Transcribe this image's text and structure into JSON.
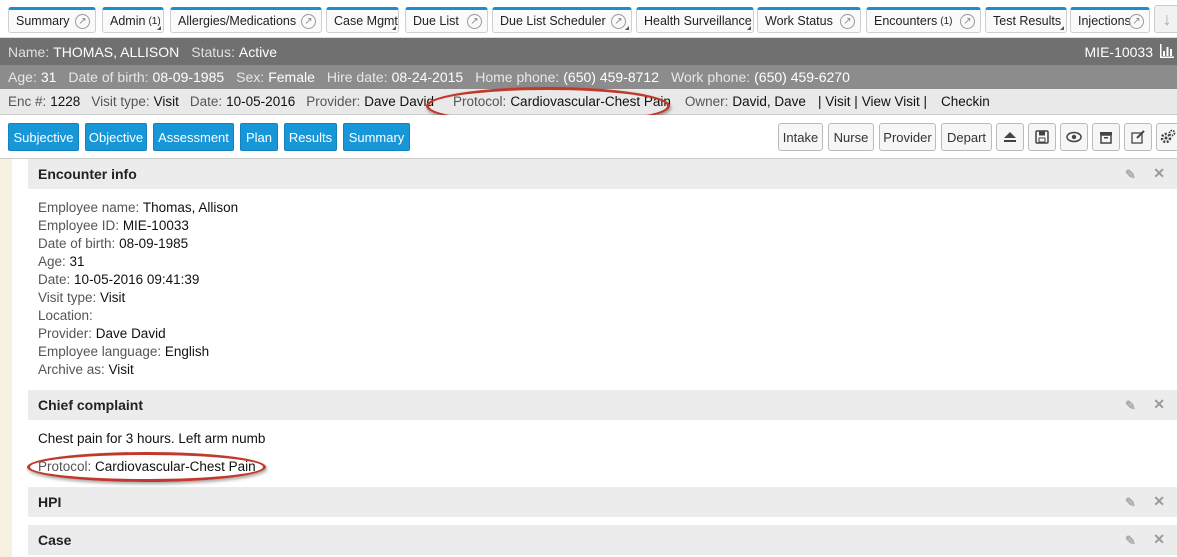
{
  "tabs": [
    {
      "label": "Summary",
      "count": ""
    },
    {
      "label": "Admin",
      "count": "(1)"
    },
    {
      "label": "Allergies/Medications",
      "count": ""
    },
    {
      "label": "Case Mgmt",
      "count": ""
    },
    {
      "label": "Due List",
      "count": ""
    },
    {
      "label": "Due List Scheduler",
      "count": ""
    },
    {
      "label": "Health Surveillance",
      "count": ""
    },
    {
      "label": "Work Status",
      "count": ""
    },
    {
      "label": "Encounters",
      "count": "(1)"
    },
    {
      "label": "Test Results",
      "count": ""
    },
    {
      "label": "Injections",
      "count": ""
    }
  ],
  "patient": {
    "name_label": "Name:",
    "name": "THOMAS, ALLISON",
    "status_label": "Status:",
    "status": "Active",
    "mrn": "MIE-10033",
    "age_label": "Age:",
    "age": "31",
    "dob_label": "Date of birth:",
    "dob": "08-09-1985",
    "sex_label": "Sex:",
    "sex": "Female",
    "hire_label": "Hire date:",
    "hire": "08-24-2015",
    "home_label": "Home phone:",
    "home": "(650) 459-8712",
    "work_label": "Work phone:",
    "work": "(650) 459-6270"
  },
  "encounter": {
    "enc_label": "Enc #:",
    "enc": "1228",
    "type_label": "Visit type:",
    "type": "Visit",
    "date_label": "Date:",
    "date": "10-05-2016",
    "provider_label": "Provider:",
    "provider": "Dave David",
    "protocol_label": "Protocol:",
    "protocol": "Cardiovascular-Chest Pain",
    "owner_label": "Owner:",
    "owner": "David, Dave",
    "visit_link": "| Visit |",
    "view_link": "View Visit |",
    "checkin_link": "Checkin"
  },
  "nav": {
    "subjective": "Subjective",
    "objective": "Objective",
    "assessment": "Assessment",
    "plan": "Plan",
    "results": "Results",
    "summary": "Summary",
    "intake": "Intake",
    "nurse": "Nurse",
    "provider": "Provider",
    "depart": "Depart"
  },
  "sections": {
    "encounter_info": "Encounter info",
    "chief_complaint": "Chief complaint",
    "hpi": "HPI",
    "case": "Case"
  },
  "encounter_info": {
    "employee_name_label": "Employee name:",
    "employee_name": "Thomas, Allison",
    "employee_id_label": "Employee ID:",
    "employee_id": "MIE-10033",
    "dob_label": "Date of birth:",
    "dob": "08-09-1985",
    "age_label": "Age:",
    "age": "31",
    "date_label": "Date:",
    "date": "10-05-2016 09:41:39",
    "visit_type_label": "Visit type:",
    "visit_type": "Visit",
    "location_label": "Location:",
    "location": "",
    "provider_label": "Provider:",
    "provider": "Dave David",
    "language_label": "Employee language:",
    "language": "English",
    "archive_label": "Archive as:",
    "archive": "Visit"
  },
  "chief_complaint": {
    "text": "Chest pain for 3 hours.  Left arm numb",
    "protocol_label": "Protocol:",
    "protocol": "Cardiovascular-Chest Pain"
  },
  "colors": {
    "accent": "#1797d8",
    "highlight": "#c0392b"
  }
}
